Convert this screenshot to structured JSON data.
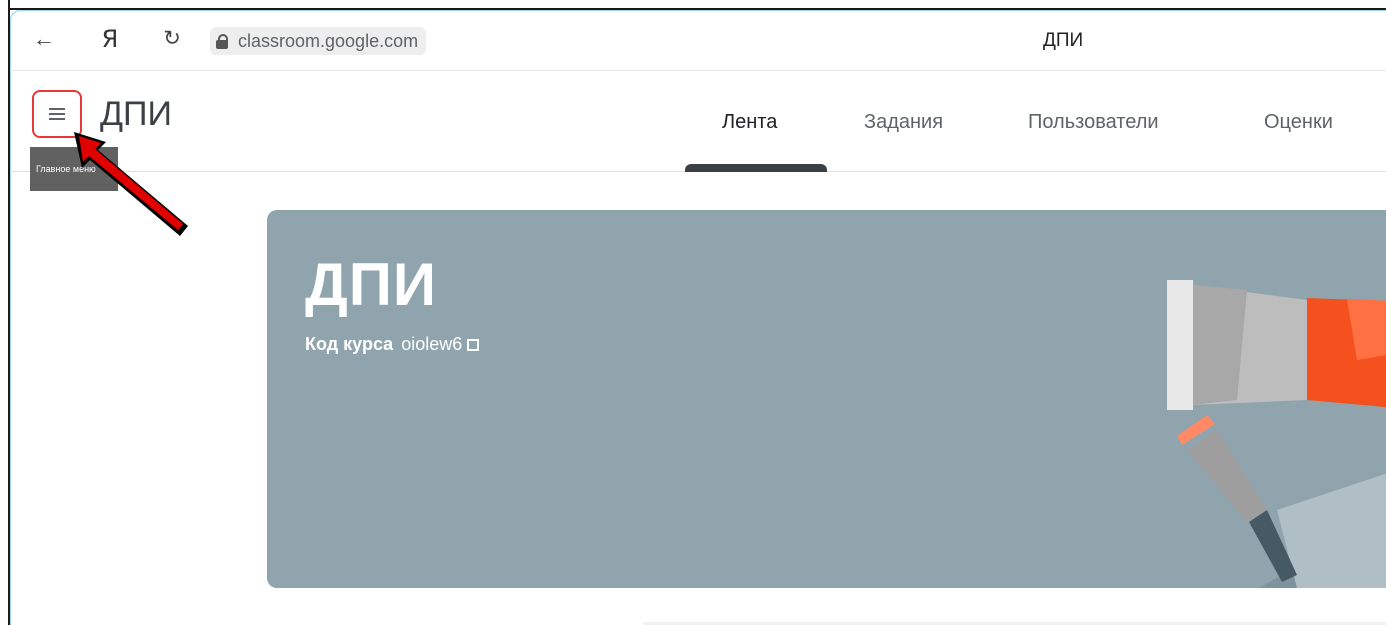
{
  "browser": {
    "back_icon": "arrow-left-icon",
    "browser_logo": "Я",
    "reload_icon": "reload-icon",
    "url": "classroom.google.com",
    "page_title": "ДПИ"
  },
  "header": {
    "menu_icon": "hamburger-menu-icon",
    "course_name": "ДПИ",
    "tabs": [
      {
        "label": "Лента",
        "active": true
      },
      {
        "label": "Задания",
        "active": false
      },
      {
        "label": "Пользователи",
        "active": false
      },
      {
        "label": "Оценки",
        "active": false
      }
    ]
  },
  "tooltip": {
    "text": "Главное меню"
  },
  "banner": {
    "title": "ДПИ",
    "code_label": "Код курса",
    "code_value": "oiolew6",
    "background_color": "#90a4ae"
  },
  "colors": {
    "highlight": "#e53935",
    "annotation_arrow": "#e00000"
  }
}
